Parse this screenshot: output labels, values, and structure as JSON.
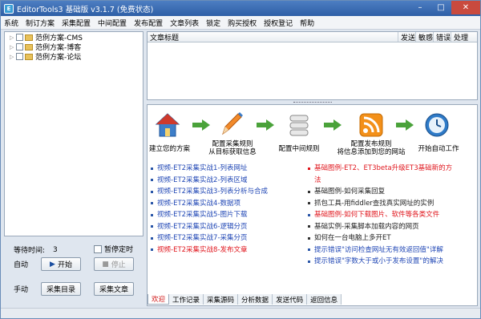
{
  "window": {
    "title": "EditorTools3 基础版 v3.1.7 (免费状态)",
    "icon_letter": "E"
  },
  "menu": [
    "系统",
    "制订方案",
    "采集配置",
    "中间配置",
    "发布配置",
    "文章列表",
    "锁定",
    "购买授权",
    "授权登记",
    "帮助"
  ],
  "tree": [
    "范例方案-CMS",
    "范例方案-博客",
    "范例方案-论坛"
  ],
  "controls": {
    "wait_label": "等待时间:",
    "wait_value": "3",
    "pause_label": "暂停定时",
    "auto_label": "自动",
    "start_label": "开始",
    "stop_label": "停止",
    "manual_label": "手动",
    "collect_dir_label": "采集目录",
    "collect_article_label": "采集文章"
  },
  "table": {
    "headers": [
      "文章标题",
      "发送",
      "敏感",
      "错误",
      "处理"
    ]
  },
  "flow": [
    {
      "label": "建立您的方案",
      "icon": "house-icon"
    },
    {
      "label": "配置采集规则\n从目标获取信息",
      "icon": "pencil-icon"
    },
    {
      "label": "配置中间规则",
      "icon": "database-icon"
    },
    {
      "label": "配置发布规则\n将信息添加到您的网站",
      "icon": "rss-icon"
    },
    {
      "label": "开始自动工作",
      "icon": "clock-icon"
    }
  ],
  "left_links": [
    {
      "text": "视频-ET2采集实战1-列表网址",
      "color": "blue"
    },
    {
      "text": "视频-ET2采集实战2-列表区域",
      "color": "blue"
    },
    {
      "text": "视频-ET2采集实战3-列表分析与合成",
      "color": "blue"
    },
    {
      "text": "视频-ET2采集实战4-数据项",
      "color": "blue"
    },
    {
      "text": "视频-ET2采集实战5-图片下载",
      "color": "blue"
    },
    {
      "text": "视频-ET2采集实战6-逻辑分页",
      "color": "blue"
    },
    {
      "text": "视频-ET2采集实战7-采集分页",
      "color": "blue"
    },
    {
      "text": "视频-ET2采集实战8-发布文章",
      "color": "red"
    }
  ],
  "right_links": [
    {
      "text": "基础图例-ET2、ET3beta升级ET3基础新的方",
      "cont": "法",
      "color": "red",
      "bullet": "red"
    },
    {
      "text": "基础图例-如何采集回复",
      "color": "black"
    },
    {
      "text": "抓包工具-用fiddler查找真实网址的实例",
      "color": "black"
    },
    {
      "text": "基础图例-如何下载图片、软件等各类文件",
      "color": "red"
    },
    {
      "text": "基础实例-采集脚本加载内容的网页",
      "color": "black"
    },
    {
      "text": "如何在一台电脑上多开ET",
      "color": "black"
    },
    {
      "text": "提示错误\"访问检查网址无有效返回值\"详解",
      "color": "blue"
    },
    {
      "text": "提示错误\"字数大于或小于发布设置\"的解决",
      "color": "blue"
    }
  ],
  "tabs": [
    "欢迎",
    "工作记录",
    "采集源码",
    "分析数据",
    "发送代码",
    "返回信息"
  ],
  "colors": {
    "title_bar": "#2e5fa6",
    "link_blue": "#2047b5",
    "link_red": "#e0161d"
  }
}
